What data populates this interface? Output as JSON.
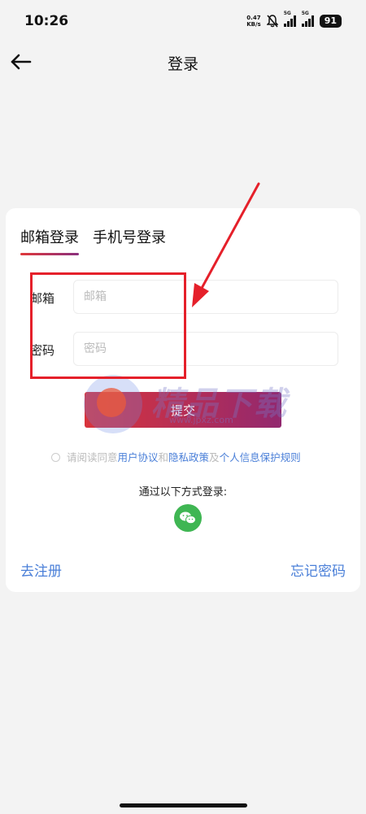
{
  "status_bar": {
    "time": "10:26",
    "net_speed_value": "0.47",
    "net_speed_unit": "KB/s",
    "signal_1_label": "5G",
    "signal_2_label": "5G",
    "battery": "91"
  },
  "header": {
    "title": "登录"
  },
  "login_card": {
    "tabs": [
      {
        "label": "邮箱登录",
        "active": true
      },
      {
        "label": "手机号登录",
        "active": false
      }
    ],
    "email_label": "邮箱",
    "email_placeholder": "邮箱",
    "password_label": "密码",
    "password_placeholder": "密码",
    "submit_label": "提交",
    "agreement": {
      "prefix": "请阅读同意",
      "user_agreement": "用户协议",
      "and": "和",
      "privacy_policy": "隐私政策",
      "and2": "及",
      "personal_info_rules": "个人信息保护规则"
    },
    "alt_login_title": "通过以下方式登录:",
    "register_label": "去注册",
    "forgot_label": "忘记密码"
  },
  "watermark": {
    "text": "精品下载",
    "url": "www.jpxz.com"
  },
  "colors": {
    "accent_link": "#4a7fd8",
    "annotation_red": "#e5202a",
    "wechat_green": "#3fb653"
  }
}
